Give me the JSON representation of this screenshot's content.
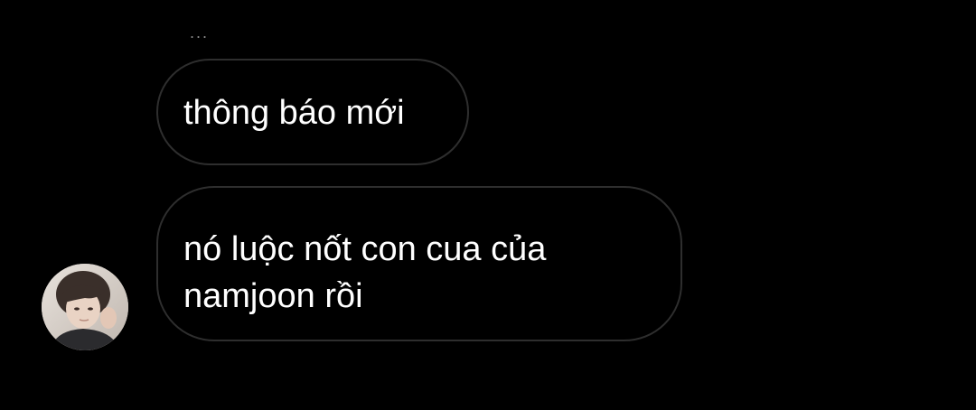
{
  "thread": {
    "typing_indicator": "...",
    "messages": [
      {
        "text": "thông báo mới"
      },
      {
        "text": "nó luộc nốt con cua của namjoon rồi"
      }
    ],
    "sender_avatar_icon": "user-avatar-photo"
  },
  "colors": {
    "background": "#000000",
    "bubble_border": "#2e2e2e",
    "text": "#ffffff",
    "muted": "#8a8a8a"
  }
}
